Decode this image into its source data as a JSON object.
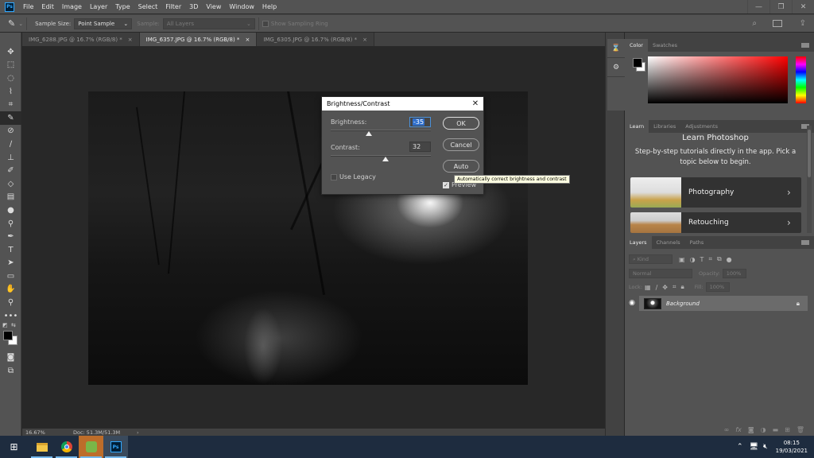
{
  "app": {
    "logo": "Ps",
    "name": "Photoshop"
  },
  "menu": [
    "File",
    "Edit",
    "Image",
    "Layer",
    "Type",
    "Select",
    "Filter",
    "3D",
    "View",
    "Window",
    "Help"
  ],
  "window_controls": {
    "minimize": "—",
    "restore": "❐",
    "close": "✕"
  },
  "options_bar": {
    "tool_icon": "eyedropper-icon",
    "sample_size_label": "Sample Size:",
    "sample_size_value": "Point Sample",
    "sample_label": "Sample:",
    "sample_value": "All Layers",
    "show_sampling_ring_label": "Show Sampling Ring",
    "show_sampling_ring_checked": false
  },
  "document_tabs": [
    {
      "label": "IMG_6288.JPG @ 16.7% (RGB/8) *",
      "active": false
    },
    {
      "label": "IMG_6357.JPG @ 16.7% (RGB/8) *",
      "active": true
    },
    {
      "label": "IMG_6305.JPG @ 16.7% (RGB/8) *",
      "active": false
    }
  ],
  "tab_close": "×",
  "tools": [
    "move-tool",
    "marquee-tool",
    "lasso-tool",
    "quick-selection-tool",
    "crop-tool",
    "eyedropper-tool",
    "healing-brush-tool",
    "brush-tool",
    "clone-stamp-tool",
    "history-brush-tool",
    "eraser-tool",
    "gradient-tool",
    "blur-tool",
    "dodge-tool",
    "pen-tool",
    "type-tool",
    "path-selection-tool",
    "rectangle-tool",
    "hand-tool",
    "zoom-tool",
    "more-tools"
  ],
  "active_tool": "eyedropper-tool",
  "status": {
    "zoom": "16.67%",
    "doc": "Doc: 51.3M/51.3M",
    "arrow": "›"
  },
  "dialog": {
    "title": "Brightness/Contrast",
    "close": "✕",
    "brightness_label": "Brightness:",
    "brightness_value": "-35",
    "brightness_range": [
      -150,
      150
    ],
    "contrast_label": "Contrast:",
    "contrast_value": "32",
    "contrast_range": [
      -50,
      100
    ],
    "use_legacy_label": "Use Legacy",
    "use_legacy_checked": false,
    "preview_label": "Preview",
    "preview_checked": true,
    "ok_label": "OK",
    "cancel_label": "Cancel",
    "auto_label": "Auto",
    "tooltip": "Automatically correct brightness and contrast"
  },
  "color_panel": {
    "tabs": [
      "Color",
      "Swatches"
    ],
    "foreground": "#000000",
    "background": "#ffffff",
    "hue_color": "#ff0000"
  },
  "learn_panel": {
    "tabs": [
      "Learn",
      "Libraries",
      "Adjustments"
    ],
    "title": "Learn Photoshop",
    "description": "Step-by-step tutorials directly in the app. Pick a topic below to begin.",
    "cards": [
      {
        "label": "Photography",
        "chevron": "›"
      },
      {
        "label": "Retouching",
        "chevron": "›"
      }
    ]
  },
  "layers_panel": {
    "tabs": [
      "Layers",
      "Channels",
      "Paths"
    ],
    "filter_placeholder": "Kind",
    "blend_mode": "Normal",
    "opacity_label": "Opacity:",
    "opacity_value": "100%",
    "lock_label": "Lock:",
    "fill_label": "Fill:",
    "fill_value": "100%",
    "layers": [
      {
        "name": "Background",
        "visible": true,
        "locked": true
      }
    ]
  },
  "taskbar": {
    "items": [
      "windows-start",
      "file-explorer",
      "chrome",
      "green-app",
      "photoshop"
    ],
    "time": "08:15",
    "date": "19/03/2021"
  }
}
